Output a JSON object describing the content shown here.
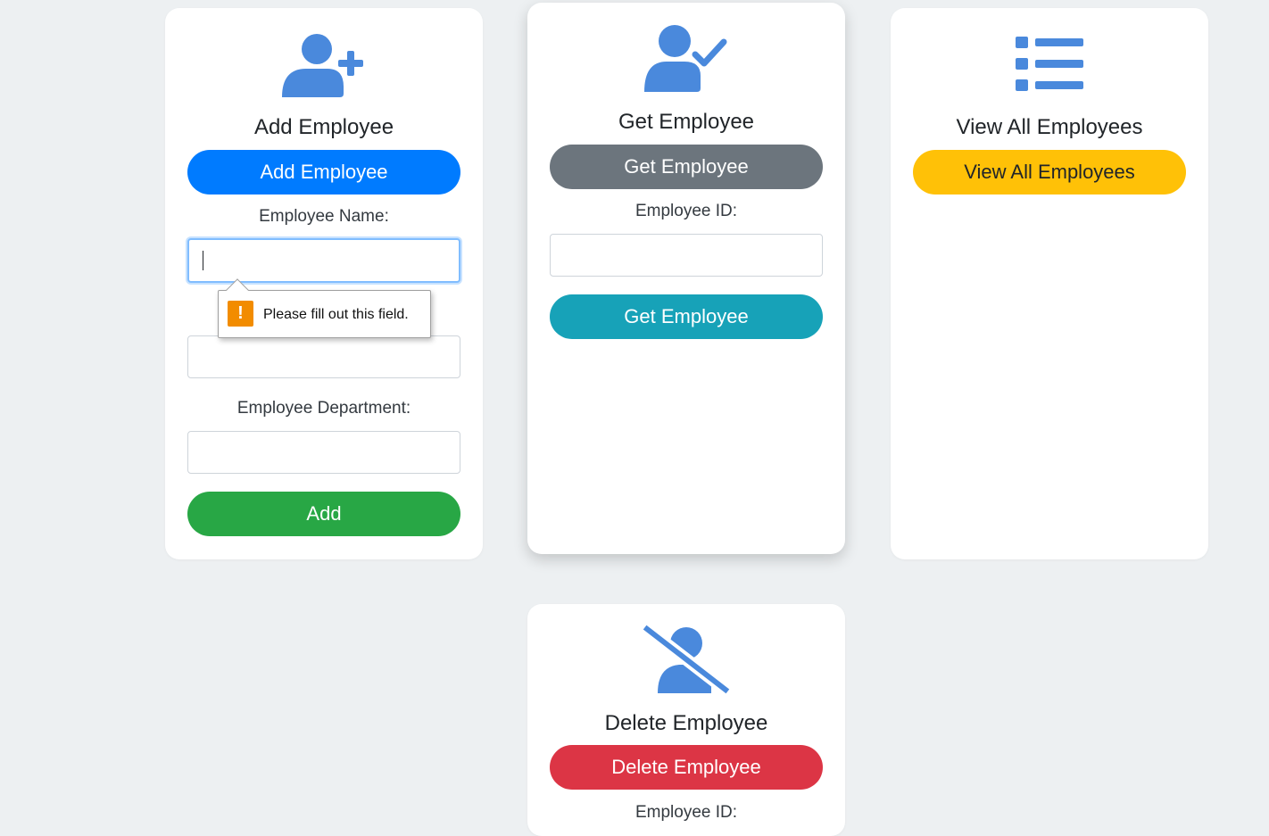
{
  "add_card": {
    "title": "Add Employee",
    "toggle_button": "Add Employee",
    "name_label": "Employee Name:",
    "name_value": "",
    "validation_message": "Please fill out this field.",
    "validation_badge": "!",
    "id_value": "",
    "department_label": "Employee Department:",
    "department_value": "",
    "submit_button": "Add",
    "icon": "user-plus-icon"
  },
  "get_card": {
    "title": "Get Employee",
    "toggle_button": "Get Employee",
    "id_label": "Employee ID:",
    "id_value": "",
    "submit_button": "Get Employee",
    "icon": "user-check-icon"
  },
  "view_card": {
    "title": "View All Employees",
    "toggle_button": "View All Employees",
    "icon": "list-icon"
  },
  "delete_card": {
    "title": "Delete Employee",
    "toggle_button": "Delete Employee",
    "id_label": "Employee ID:",
    "icon": "user-slash-icon"
  },
  "colors": {
    "icon": "#4a89dc",
    "primary": "#007bff",
    "secondary": "#6c757d",
    "warning": "#ffc107",
    "success": "#28a745",
    "info": "#17a2b8",
    "danger": "#dc3545",
    "background": "#edf0f2"
  }
}
